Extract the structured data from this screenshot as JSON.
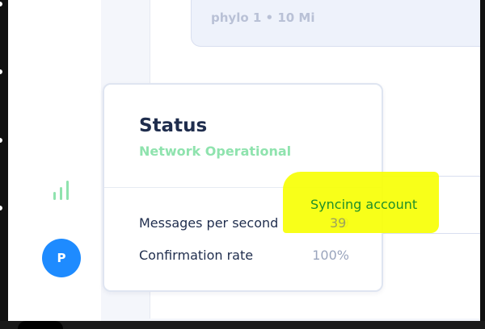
{
  "background_card": {
    "meta": "phylo 1 • 10 Mi"
  },
  "sidebar": {
    "avatar_initial": "P"
  },
  "status_card": {
    "title": "Status",
    "subtitle": "Network Operational",
    "stats": [
      {
        "label": "Messages per second",
        "value": "39"
      },
      {
        "label": "Confirmation rate",
        "value": "100%"
      }
    ]
  },
  "annotation": {
    "text": "Syncing account",
    "highlight_color": "#f7ff05",
    "text_color": "#1f8f2a"
  },
  "colors": {
    "accent_green": "#8fe3ae",
    "avatar_blue": "#1e8bff",
    "title_navy": "#1f2d4d"
  }
}
